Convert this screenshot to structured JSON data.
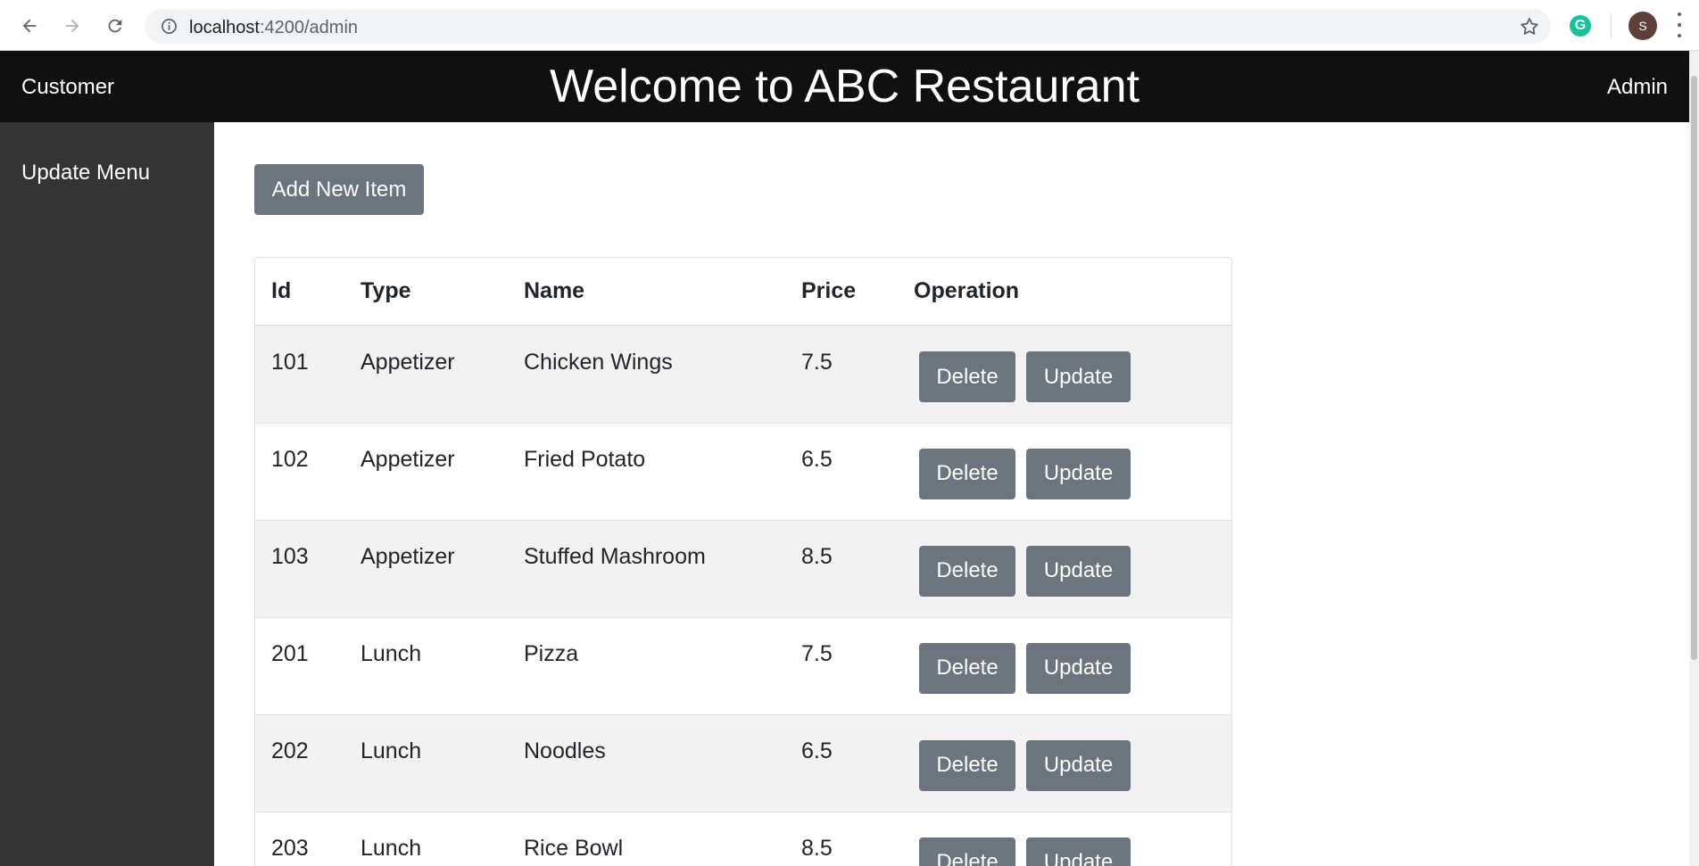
{
  "browser": {
    "url_host": "localhost",
    "url_path": ":4200/admin",
    "profile_initial": "S",
    "extension_letter": "G"
  },
  "header": {
    "left_link": "Customer",
    "title": "Welcome to ABC Restaurant",
    "right_link": "Admin"
  },
  "sidebar": {
    "items": [
      {
        "label": "Update Menu"
      }
    ]
  },
  "main": {
    "add_button": "Add New Item",
    "table": {
      "headers": [
        "Id",
        "Type",
        "Name",
        "Price",
        "Operation"
      ],
      "rows": [
        {
          "id": "101",
          "type": "Appetizer",
          "name": "Chicken Wings",
          "price": "7.5"
        },
        {
          "id": "102",
          "type": "Appetizer",
          "name": "Fried Potato",
          "price": "6.5"
        },
        {
          "id": "103",
          "type": "Appetizer",
          "name": "Stuffed Mashroom",
          "price": "8.5"
        },
        {
          "id": "201",
          "type": "Lunch",
          "name": "Pizza",
          "price": "7.5"
        },
        {
          "id": "202",
          "type": "Lunch",
          "name": "Noodles",
          "price": "6.5"
        },
        {
          "id": "203",
          "type": "Lunch",
          "name": "Rice Bowl",
          "price": "8.5"
        }
      ],
      "delete_label": "Delete",
      "update_label": "Update"
    }
  },
  "colors": {
    "header_bg": "#101010",
    "sidebar_bg": "#343434",
    "button_bg": "#6c757d",
    "stripe_bg": "#f2f2f2"
  }
}
